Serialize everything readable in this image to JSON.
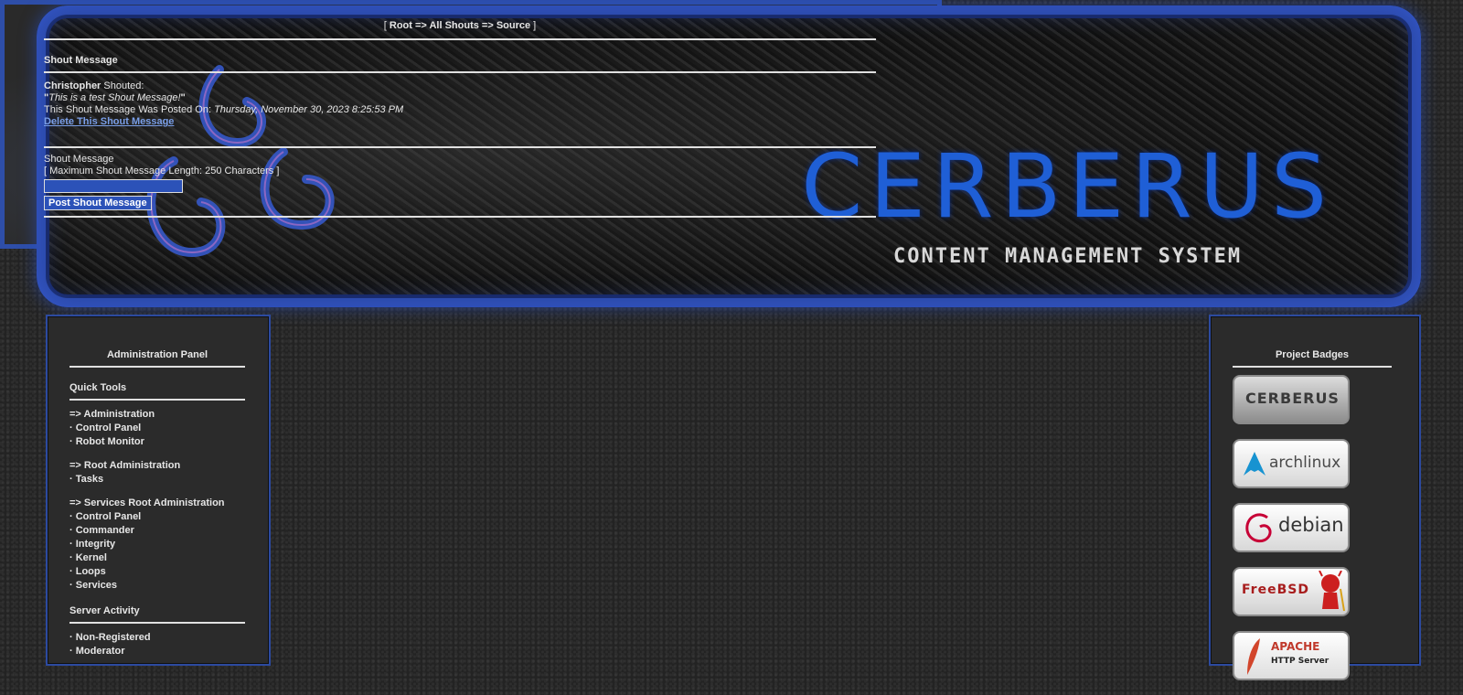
{
  "banner": {
    "brand_name": "CERBERUS",
    "brand_tagline": "CONTENT MANAGEMENT SYSTEM"
  },
  "left_panel": {
    "title": "Administration Panel",
    "quick_tools": "Quick Tools",
    "groups": [
      {
        "header": "=> Administration",
        "items": [
          "Control Panel",
          "Robot Monitor"
        ]
      },
      {
        "header": "=> Root Administration",
        "items": [
          "Tasks"
        ]
      },
      {
        "header": "=> Services Root Administration",
        "items": [
          "Control Panel",
          "Commander",
          "Integrity",
          "Kernel",
          "Loops",
          "Services"
        ]
      }
    ],
    "server_activity": "Server Activity",
    "activity_items": [
      "Non-Registered",
      "Moderator"
    ],
    "bullet": "·"
  },
  "center_panel": {
    "breadcrumb_open": "[ ",
    "breadcrumb": "Root => All Shouts => Source",
    "breadcrumb_close": " ]",
    "section_title": "Shout Message",
    "author": "Christopher",
    "shouted_label": " Shouted:",
    "message": "This is a test Shout Message!",
    "posted_label": "This Shout Message Was Posted On: ",
    "posted_date": "Thursday, November 30, 2023 8:25:53 PM",
    "delete_link": "Delete This Shout Message",
    "form_label": "Shout Message",
    "max_length_note": "[ Maximum Shout Message Length: 250 Characters ]",
    "input_value": "",
    "submit_label": "Post Shout Message"
  },
  "right_panel": {
    "title": "Project Badges",
    "badges": [
      {
        "name": "cerberus-badge",
        "text": "CERBERUS"
      },
      {
        "name": "archlinux-badge",
        "text": "archlinux"
      },
      {
        "name": "debian-badge",
        "text": "debian"
      },
      {
        "name": "freebsd-badge",
        "text": "FreeBSD"
      },
      {
        "name": "apache-badge",
        "text": "APACHE",
        "subtext": "HTTP Server"
      }
    ]
  },
  "colors": {
    "accent_blue": "#2c4aa0",
    "link_blue": "#7a9fe8",
    "panel_bg": "#2b2b2b"
  }
}
